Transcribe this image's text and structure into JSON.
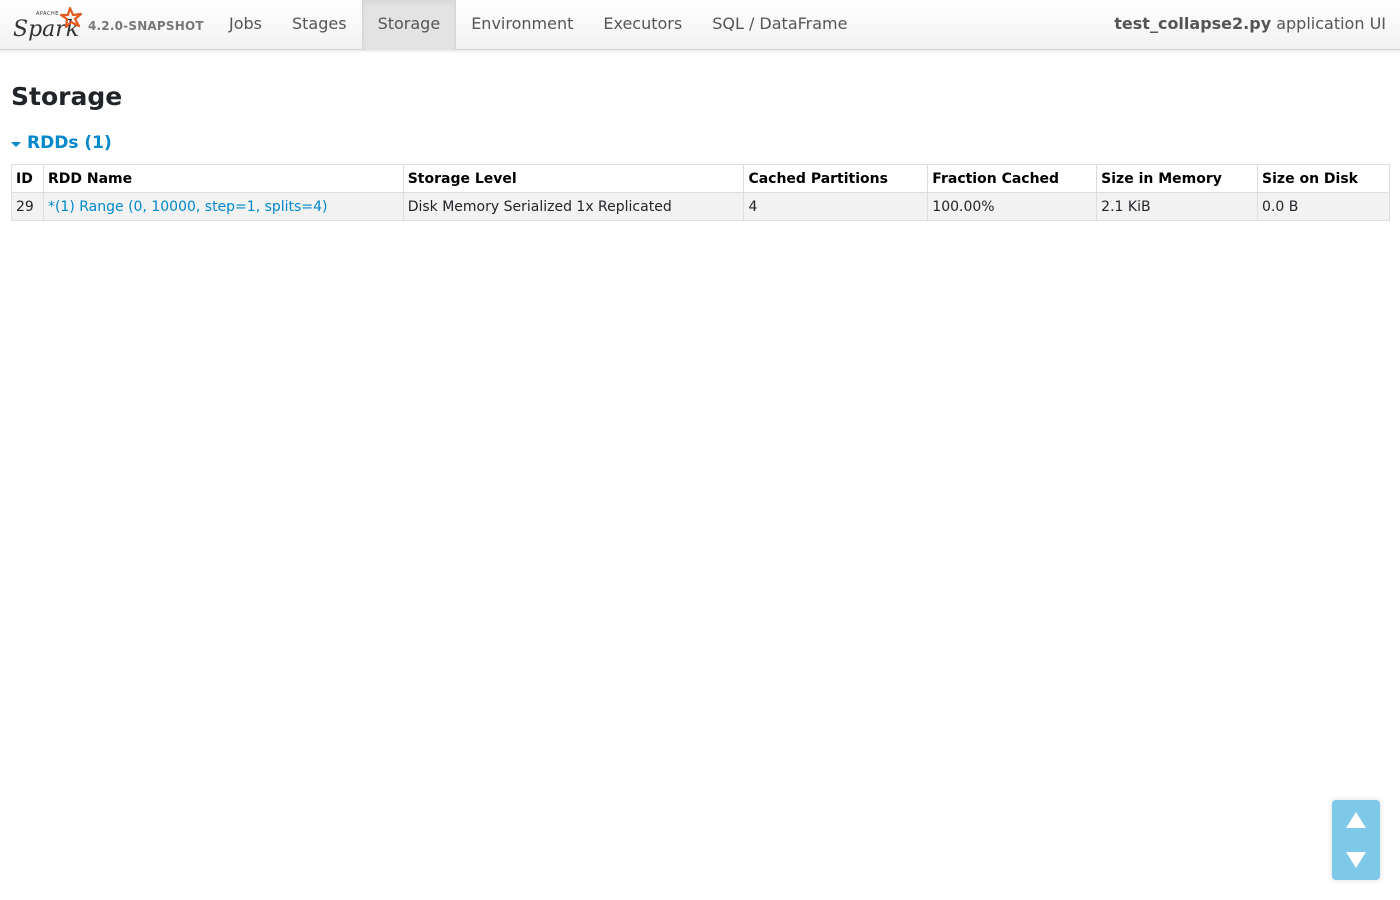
{
  "navbar": {
    "brand_small": "APACHE",
    "brand_name": "Spark",
    "version": "4.2.0-SNAPSHOT",
    "tabs": [
      {
        "label": "Jobs",
        "active": false
      },
      {
        "label": "Stages",
        "active": false
      },
      {
        "label": "Storage",
        "active": true
      },
      {
        "label": "Environment",
        "active": false
      },
      {
        "label": "Executors",
        "active": false
      },
      {
        "label": "SQL / DataFrame",
        "active": false
      }
    ],
    "app_name": "test_collapse2.py",
    "app_suffix": "application UI"
  },
  "page": {
    "title": "Storage",
    "section_label": "RDDs (1)"
  },
  "table": {
    "headers": [
      "ID",
      "RDD Name",
      "Storage Level",
      "Cached Partitions",
      "Fraction Cached",
      "Size in Memory",
      "Size on Disk"
    ],
    "rows": [
      {
        "id": "29",
        "name": "*(1) Range (0, 10000, step=1, splits=4)",
        "storage_level": "Disk Memory Serialized 1x Replicated",
        "cached_partitions": "4",
        "fraction_cached": "100.00%",
        "size_in_memory": "2.1 KiB",
        "size_on_disk": "0.0 B"
      }
    ]
  },
  "colors": {
    "link": "#0088cc",
    "active_tab_bg": "#e3e3e3",
    "row_bg": "#f2f2f2",
    "scroll_widget": "#7ec8e8",
    "spark_orange": "#e25a1c"
  },
  "icons": {
    "brand": "spark-logo",
    "section_toggle": "caret-down-icon",
    "scroll_up": "arrow-up-icon",
    "scroll_down": "arrow-down-icon"
  }
}
